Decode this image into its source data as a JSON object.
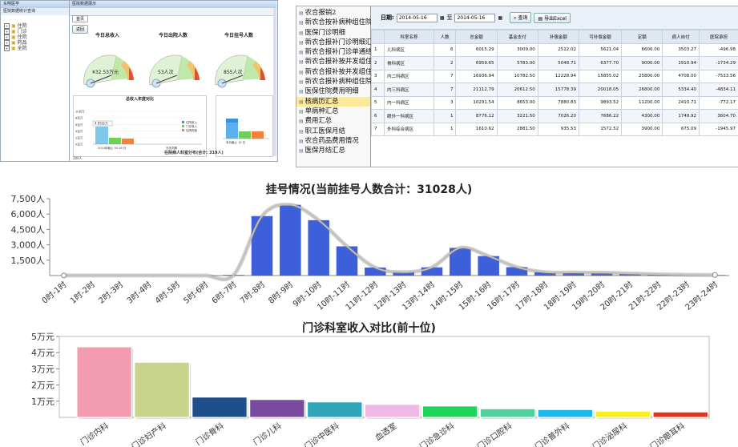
{
  "panel1": {
    "sidebar_title": "东明医学",
    "sidebar_subtitle": "医院数据统计查询",
    "tree_items": [
      "住院",
      "门诊",
      "住院",
      "药品",
      "全院"
    ],
    "main_header": "医院数据展示",
    "tab": "首页",
    "back_button": "返回",
    "gauges": [
      {
        "title": "今日总收入",
        "value": "¥32.53万元"
      },
      {
        "title": "今日出院人数",
        "value": "53人次"
      },
      {
        "title": "今日挂号人数",
        "value": "855人次"
      }
    ],
    "annual_title": "总收入年度对比",
    "annual_label": "4.85百万",
    "annual_legend": [
      "住院收入",
      "门诊收入",
      "住院药费"
    ],
    "annual_axis": [
      "10百万",
      "8百万",
      "6百万",
      "4百万",
      "2百万",
      "0百万"
    ],
    "annual_xticks": [
      "2014年截止 05-16 日",
      "去年同期"
    ],
    "right_xtick": "本月截止 15 日",
    "bottom_title": "在院病人科室分布(合计: 319人)",
    "bottom_axis": "200人"
  },
  "panel2": {
    "menu": [
      "农合报销2",
      "新农合按补病种组住院",
      "医保门诊明细",
      "新农合报补门诊明细汇总",
      "新农合报补门诊单通结",
      "新农合报补按并发组住院",
      "新农合报补按并发组住院",
      "新农合报补病种组住院",
      "医保住院费用明细",
      "核病历汇总",
      "单病种汇总",
      "费用汇总",
      "职工医保月结",
      "农合药品费用情况",
      "医保月结汇总"
    ],
    "selected_menu": "核病历汇总",
    "date_label": "日期:",
    "date_from": "2014-05-16",
    "date_to_label": "至",
    "date_to": "2014-05-16",
    "query_button": "查询",
    "export_button": "导出Excel",
    "columns": [
      "科室名称",
      "人数",
      "总金额",
      "基金支付",
      "补偿金额",
      "可补偿金额",
      "定额",
      "病人自付",
      "医院承担"
    ],
    "rows": [
      [
        "1",
        "儿科病区",
        "6",
        "6015.29",
        "3009.00",
        "2512.02",
        "5621.04",
        "6600.00",
        "3503.27",
        "-496.98"
      ],
      [
        "2",
        "骨科病区",
        "2",
        "6959.65",
        "5783.00",
        "5048.71",
        "6377.70",
        "9000.00",
        "1910.94",
        "-1734.29"
      ],
      [
        "3",
        "内二科病区",
        "7",
        "16936.94",
        "10782.50",
        "12228.94",
        "15855.02",
        "25800.00",
        "4708.00",
        "-7533.56"
      ],
      [
        "4",
        "内三科病区",
        "7",
        "21112.79",
        "20612.50",
        "15778.39",
        "20018.05",
        "26800.00",
        "5334.40",
        "-4834.11"
      ],
      [
        "5",
        "内一科病区",
        "3",
        "10291.54",
        "8653.00",
        "7880.83",
        "9893.52",
        "11200.00",
        "2410.71",
        "-772.17"
      ],
      [
        "6",
        "眼外一科病区",
        "1",
        "8776.12",
        "3221.50",
        "7026.20",
        "7686.22",
        "4300.00",
        "1749.92",
        "3604.70"
      ],
      [
        "7",
        "外科综合病区",
        "1",
        "1610.62",
        "2881.50",
        "935.53",
        "1572.52",
        "3900.00",
        "675.09",
        "-1945.97"
      ]
    ]
  },
  "chart_registration": {
    "title": "挂号情况(当前挂号人数合计：31028人)",
    "y_ticks": [
      "7,500人",
      "6,000人",
      "4,500人",
      "3,000人",
      "1,500人"
    ],
    "color": "#3d5fd9"
  },
  "chart_income": {
    "title": "门诊科室收入对比(前十位)",
    "y_ticks": [
      "5万元",
      "4万元",
      "3万元",
      "2万元",
      "1万元"
    ]
  },
  "chart_data": [
    {
      "type": "bar",
      "title": "挂号情况(当前挂号人数合计：31028人)",
      "categories": [
        "0时-1时",
        "1时-2时",
        "2时-3时",
        "3时-4时",
        "4时-5时",
        "5时-6时",
        "6时-7时",
        "7时-8时",
        "8时-9时",
        "9时-10时",
        "10时-11时",
        "11时-12时",
        "12时-13时",
        "13时-14时",
        "14时-15时",
        "15时-16时",
        "16时-17时",
        "17时-18时",
        "18时-19时",
        "19时-20时",
        "20时-21时",
        "21时-22时",
        "22时-23时",
        "23时-24时"
      ],
      "values": [
        10,
        5,
        5,
        5,
        5,
        5,
        60,
        5800,
        6900,
        5400,
        2850,
        780,
        330,
        800,
        2700,
        1900,
        820,
        330,
        300,
        280,
        200,
        120,
        80,
        50
      ],
      "ylim": [
        0,
        7500
      ],
      "smooth_line": true
    },
    {
      "type": "bar",
      "title": "门诊科室收入对比(前十位)",
      "categories": [
        "门诊内科",
        "门诊妇产科",
        "门诊骨科",
        "门诊儿科",
        "门诊中医科",
        "血透室",
        "门诊急诊科",
        "门诊口腔科",
        "门诊普外科",
        "门诊泌尿科",
        "门诊眼耳科"
      ],
      "values": [
        43500,
        34000,
        12500,
        11000,
        9500,
        8000,
        7000,
        5300,
        4800,
        3800,
        3300
      ],
      "colors": [
        "#f29bb1",
        "#c8d48c",
        "#1f4f8a",
        "#7a4a9e",
        "#2fa6b8",
        "#f0b8e6",
        "#1fd45a",
        "#4fd19c",
        "#1fb6e8",
        "#f5f01e",
        "#e0341e"
      ],
      "ylim": [
        0,
        50000
      ],
      "yunit": "万元"
    }
  ]
}
